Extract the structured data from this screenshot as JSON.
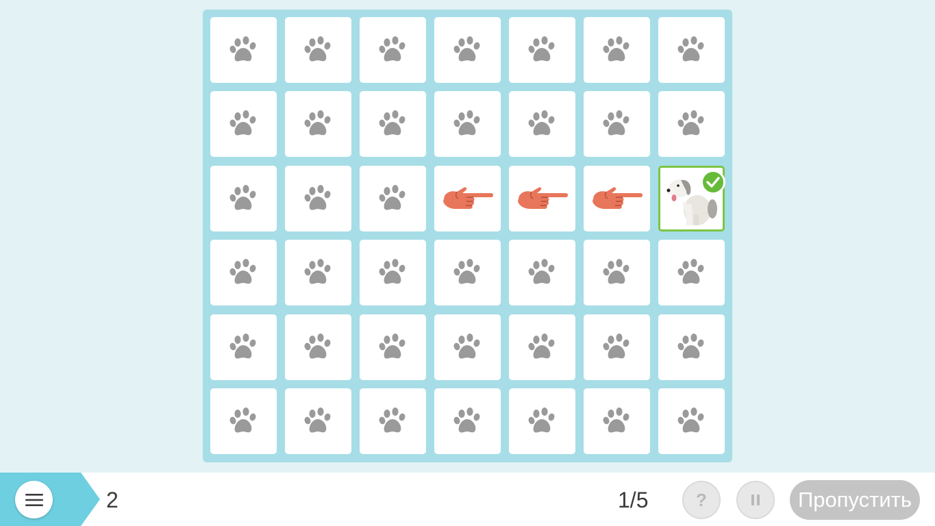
{
  "board": {
    "rows": 6,
    "cols": 7,
    "cells": [
      [
        "paw",
        "paw",
        "paw",
        "paw",
        "paw",
        "paw",
        "paw"
      ],
      [
        "paw",
        "paw",
        "paw",
        "paw",
        "paw",
        "paw",
        "paw"
      ],
      [
        "paw",
        "paw",
        "paw",
        "hand-right",
        "hand-right",
        "hand-right",
        "dog-found"
      ],
      [
        "paw",
        "paw",
        "paw",
        "paw",
        "paw",
        "paw",
        "paw"
      ],
      [
        "paw",
        "paw",
        "paw",
        "paw",
        "paw",
        "paw",
        "paw"
      ],
      [
        "paw",
        "paw",
        "paw",
        "paw",
        "paw",
        "paw",
        "paw"
      ]
    ]
  },
  "bottom_bar": {
    "level": "2",
    "progress": "1/5",
    "help_label": "?",
    "skip_label": "Пропустить"
  },
  "colors": {
    "background": "#e2f2f5",
    "board": "#a7dde6",
    "paw": "#9a9a9a",
    "hand": "#e8765a",
    "check": "#66bb38",
    "menu_tab": "#6dcfe0",
    "disabled_button": "#c4c4c4"
  }
}
